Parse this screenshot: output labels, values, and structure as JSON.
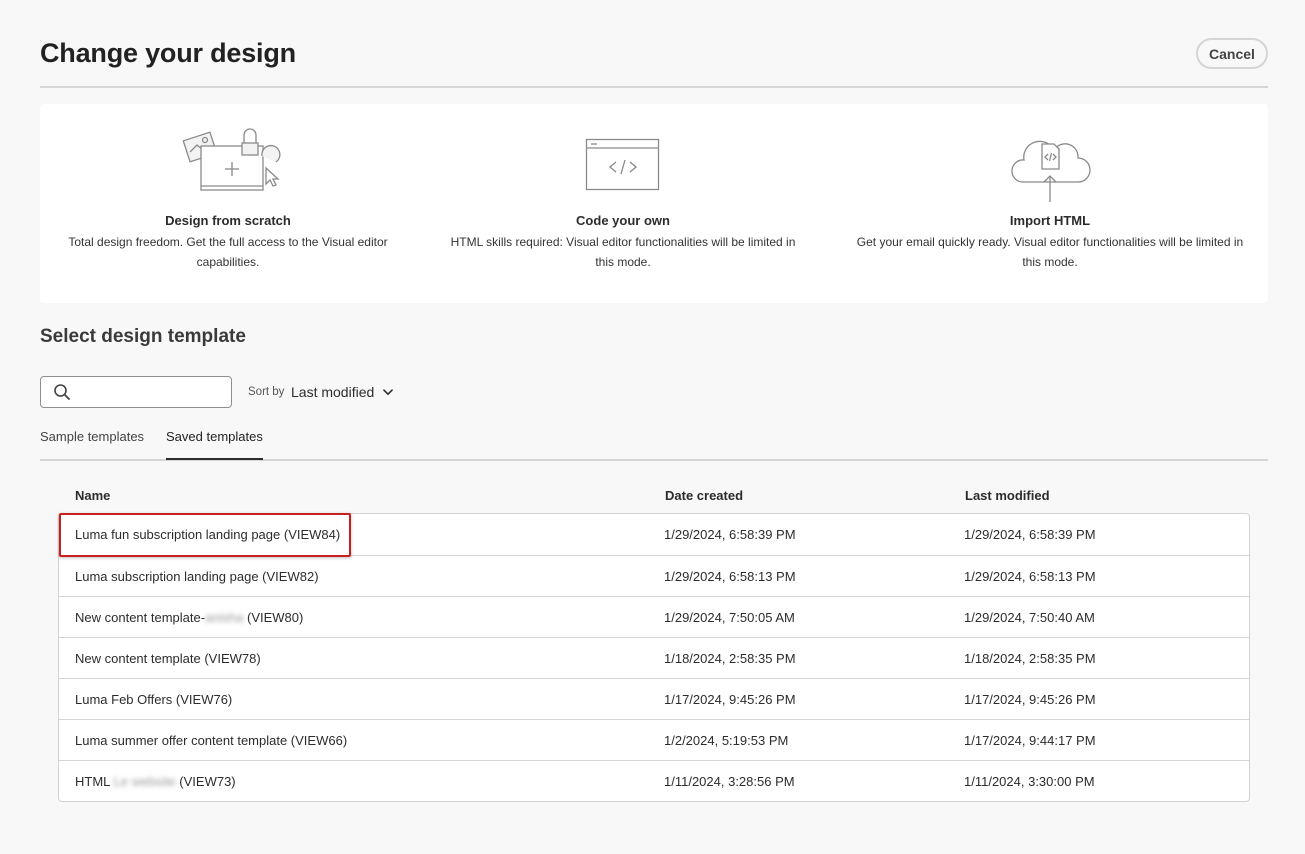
{
  "dialog": {
    "title": "Change your design",
    "cancel_label": "Cancel"
  },
  "options": [
    {
      "icon": "design-from-scratch-illustration",
      "title": "Design from scratch",
      "description": "Total design freedom. Get the full access to the Visual editor capabilities."
    },
    {
      "icon": "code-window-illustration",
      "title": "Code your own",
      "description": "HTML skills required: Visual editor functionalities will be limited in this mode."
    },
    {
      "icon": "cloud-upload-illustration",
      "title": "Import HTML",
      "description": "Get your email quickly ready. Visual editor functionalities will be limited in this mode."
    }
  ],
  "templates_section": {
    "title": "Select design template",
    "search": {
      "value": "",
      "placeholder": "",
      "icon": "search-icon"
    },
    "sort": {
      "label": "Sort by",
      "value": "Last modified",
      "icon": "chevron-down-icon"
    },
    "tabs": [
      {
        "label": "Sample templates",
        "active": false
      },
      {
        "label": "Saved templates",
        "active": true
      }
    ]
  },
  "table": {
    "columns": [
      "Name",
      "Date created",
      "Last modified"
    ],
    "rows": [
      {
        "name": "Luma fun subscription landing page (VIEW84)",
        "name_pre": "",
        "blurred": "",
        "name_post": "",
        "created": "1/29/2024, 6:58:39 PM",
        "modified": "1/29/2024, 6:58:39 PM",
        "highlighted": true
      },
      {
        "name": "Luma subscription landing page (VIEW82)",
        "name_pre": "",
        "blurred": "",
        "name_post": "",
        "created": "1/29/2024, 6:58:13 PM",
        "modified": "1/29/2024, 6:58:13 PM",
        "highlighted": false
      },
      {
        "name": "",
        "name_pre": "New content template-",
        "blurred": "anisha",
        "name_post": " (VIEW80)",
        "created": "1/29/2024, 7:50:05 AM",
        "modified": "1/29/2024, 7:50:40 AM",
        "highlighted": false
      },
      {
        "name": "New content template (VIEW78)",
        "name_pre": "",
        "blurred": "",
        "name_post": "",
        "created": "1/18/2024, 2:58:35 PM",
        "modified": "1/18/2024, 2:58:35 PM",
        "highlighted": false
      },
      {
        "name": "Luma Feb Offers (VIEW76)",
        "name_pre": "",
        "blurred": "",
        "name_post": "",
        "created": "1/17/2024, 9:45:26 PM",
        "modified": "1/17/2024, 9:45:26 PM",
        "highlighted": false
      },
      {
        "name": "Luma summer offer content template (VIEW66)",
        "name_pre": "",
        "blurred": "",
        "name_post": "",
        "created": "1/2/2024, 5:19:53 PM",
        "modified": "1/17/2024, 9:44:17 PM",
        "highlighted": false
      },
      {
        "name": "",
        "name_pre": "HTML ",
        "blurred": "Le website",
        "name_post": " (VIEW73)",
        "created": "1/11/2024, 3:28:56 PM",
        "modified": "1/11/2024, 3:30:00 PM",
        "highlighted": false
      }
    ]
  }
}
